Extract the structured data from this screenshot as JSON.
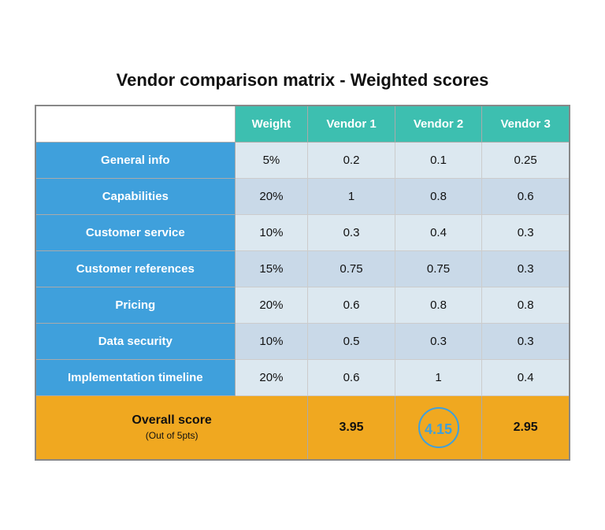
{
  "title": "Vendor comparison matrix - Weighted scores",
  "colors": {
    "header_bg": "#3dbfb0",
    "row_label_bg": "#3fa0dc",
    "alt_row_bg": "#dce8f0",
    "alt_row_bg2": "#c9d9e8",
    "footer_bg": "#f0a820",
    "highlight_circle": "#3fa0dc"
  },
  "headers": {
    "col0": "",
    "col1": "Weight",
    "col2": "Vendor 1",
    "col3": "Vendor 2",
    "col4": "Vendor 3"
  },
  "rows": [
    {
      "label": "General info",
      "weight": "5%",
      "v1": "0.2",
      "v2": "0.1",
      "v3": "0.25"
    },
    {
      "label": "Capabilities",
      "weight": "20%",
      "v1": "1",
      "v2": "0.8",
      "v3": "0.6"
    },
    {
      "label": "Customer service",
      "weight": "10%",
      "v1": "0.3",
      "v2": "0.4",
      "v3": "0.3"
    },
    {
      "label": "Customer references",
      "weight": "15%",
      "v1": "0.75",
      "v2": "0.75",
      "v3": "0.3"
    },
    {
      "label": "Pricing",
      "weight": "20%",
      "v1": "0.6",
      "v2": "0.8",
      "v3": "0.8"
    },
    {
      "label": "Data security",
      "weight": "10%",
      "v1": "0.5",
      "v2": "0.3",
      "v3": "0.3"
    },
    {
      "label": "Implementation timeline",
      "weight": "20%",
      "v1": "0.6",
      "v2": "1",
      "v3": "0.4"
    }
  ],
  "footer": {
    "label": "Overall score",
    "sublabel": "(Out of 5pts)",
    "v1": "3.95",
    "v2": "4.15",
    "v3": "2.95"
  }
}
